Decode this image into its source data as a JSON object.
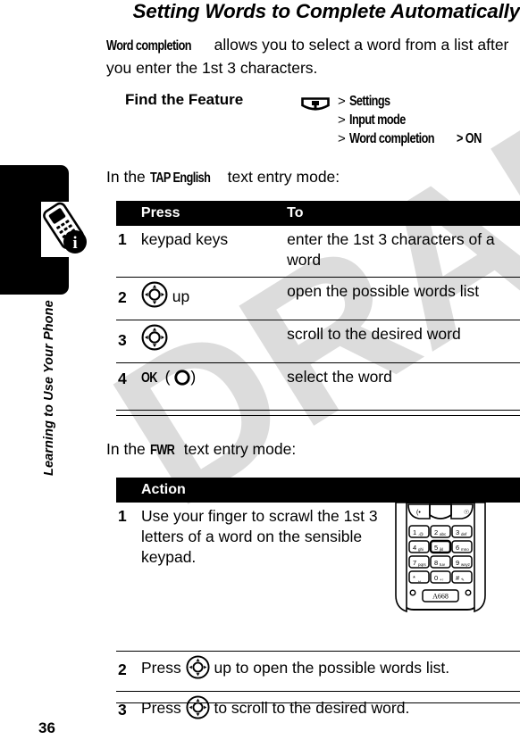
{
  "page": {
    "title": "Setting Words to Complete Automatically",
    "number": "36",
    "watermark": "DRAFT"
  },
  "sidebar": {
    "label": "Learning to Use Your Phone",
    "icon": "phone-info-icon"
  },
  "intro": {
    "bold_term": "Word completion",
    "text": " allows you to select a word from a list after you enter the 1st 3 characters."
  },
  "find_feature": {
    "label": "Find the Feature",
    "menu_icon": "menu-softkey-icon",
    "lines": [
      {
        "arrow": ">",
        "item": "Settings",
        "suffix": ""
      },
      {
        "arrow": ">",
        "item": "Input mode",
        "suffix": ""
      },
      {
        "arrow": ">",
        "item": "Word completion",
        "suffix": "> ON"
      }
    ]
  },
  "tap_section": {
    "lead_prefix": "In the ",
    "lead_mode": "TAP English",
    "lead_suffix": " text entry mode:",
    "headers": {
      "num": "",
      "press": "Press",
      "to": "To"
    },
    "rows": [
      {
        "num": "1",
        "press": "keypad keys",
        "press_icon": "",
        "press_suffix": "",
        "to": "enter the 1st 3 characters of a word"
      },
      {
        "num": "2",
        "press": "",
        "press_icon": "nav-wheel-icon",
        "press_suffix": "up",
        "to": "open the possible words list"
      },
      {
        "num": "3",
        "press": "",
        "press_icon": "nav-wheel-icon",
        "press_suffix": "",
        "to": "scroll to the desired word"
      },
      {
        "num": "4",
        "press": "OK",
        "press_icon": "select-key-icon",
        "press_suffix": "",
        "to": "select the word"
      }
    ]
  },
  "fwr_section": {
    "lead_prefix": "In the ",
    "lead_mode": "FWR",
    "lead_suffix": " text entry mode:",
    "header": "Action",
    "rows": [
      {
        "num": "1",
        "text_before": "Use your finger to scrawl the 1st 3 letters of a word on the sensible keypad.",
        "icon": "",
        "text_after": "",
        "image": "phone-keypad-image"
      },
      {
        "num": "2",
        "text_before": "Press ",
        "icon": "nav-wheel-icon",
        "text_after": " up to open the possible words list.",
        "image": ""
      },
      {
        "num": "3",
        "text_before": "Press ",
        "icon": "nav-wheel-icon",
        "text_after": " to scroll to the desired word.",
        "image": ""
      }
    ]
  },
  "keypad": {
    "model": "A668",
    "keys": [
      [
        "1",
        "2",
        "3"
      ],
      [
        "4",
        "5",
        "6"
      ],
      [
        "7",
        "8",
        "9"
      ],
      [
        "*",
        "0",
        "#"
      ]
    ],
    "key_sublabels": [
      [
        "",
        "abc",
        "def"
      ],
      [
        "ghi",
        "jkl",
        "mno"
      ],
      [
        "pqrs",
        "tuv",
        "wxyz"
      ],
      [
        "",
        "+",
        ""
      ]
    ]
  },
  "colors": {
    "ink": "#000000",
    "paper": "#ffffff",
    "watermark": "#dcdcdc"
  }
}
